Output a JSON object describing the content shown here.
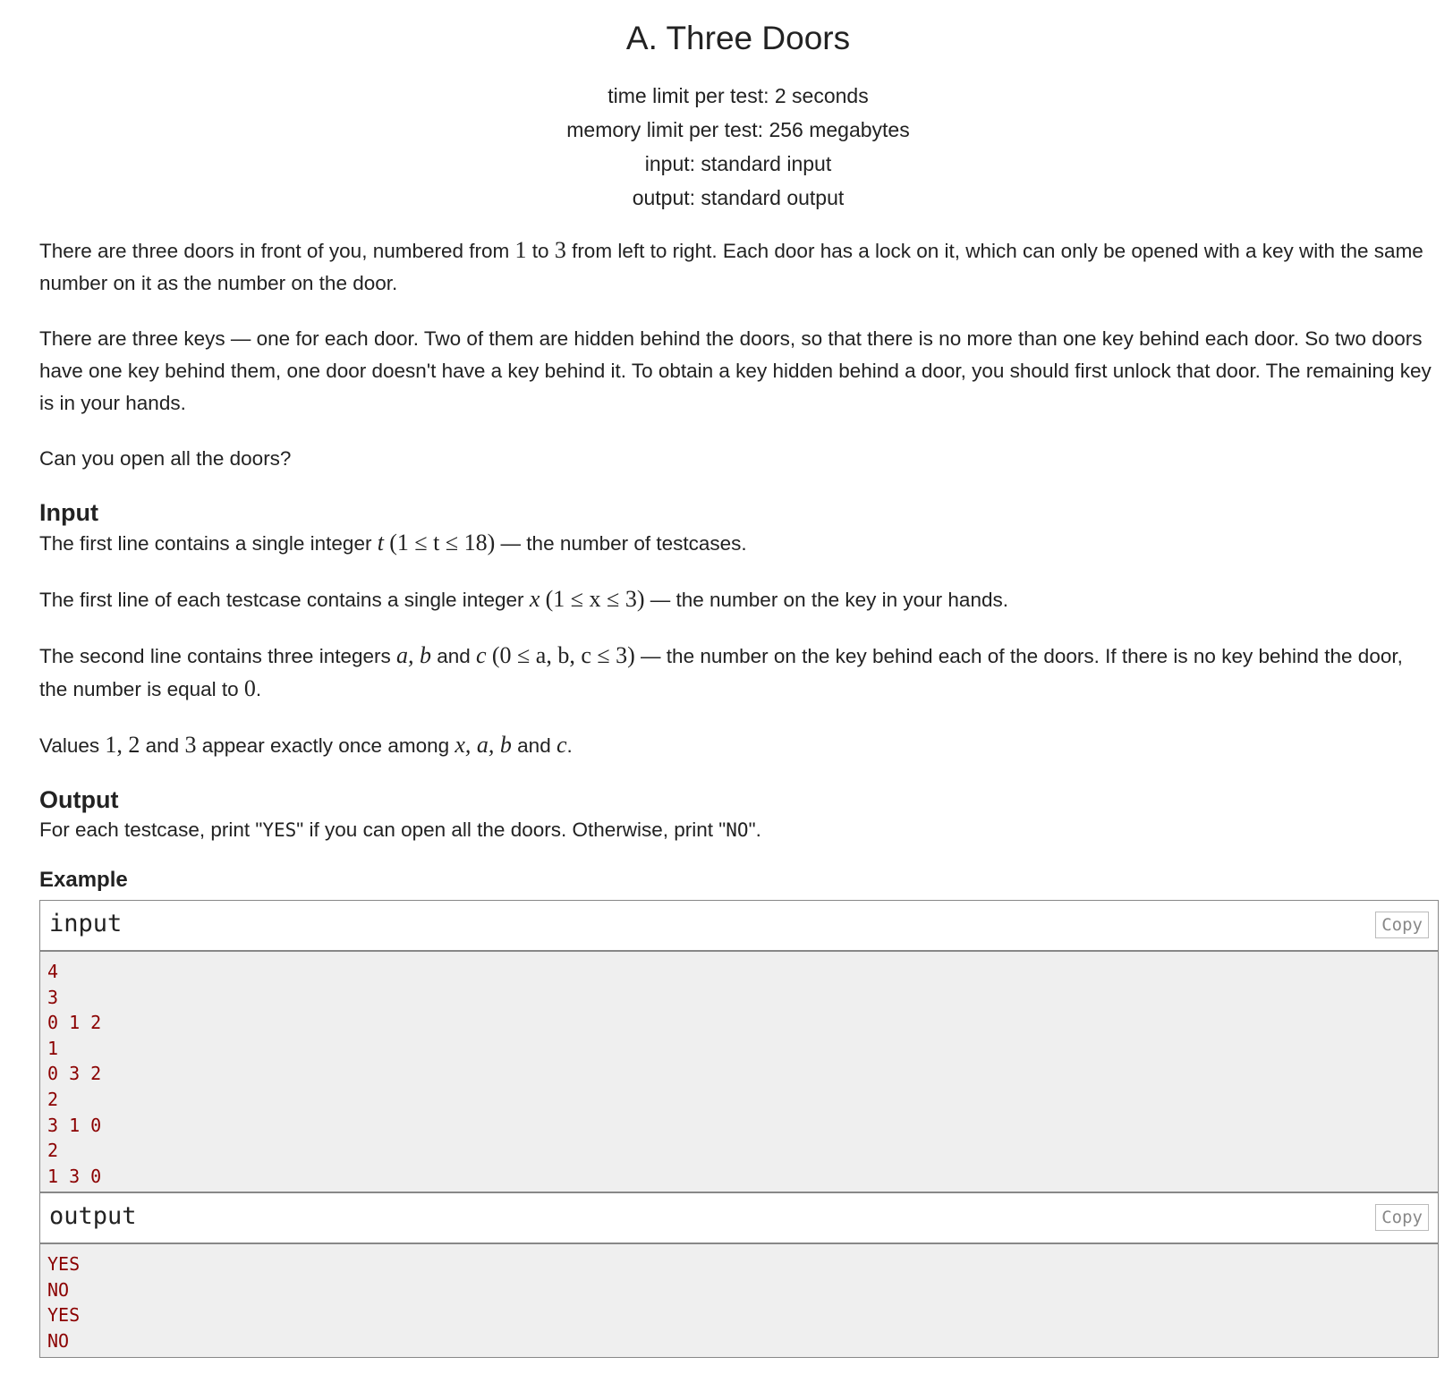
{
  "title": "A. Three Doors",
  "meta": [
    "time limit per test: 2 seconds",
    "memory limit per test: 256 megabytes",
    "input: standard input",
    "output: standard output"
  ],
  "legend": {
    "p1a": "There are three doors in front of you, numbered from ",
    "p1n1": "1",
    "p1b": " to ",
    "p1n2": "3",
    "p1c": " from left to right. Each door has a lock on it, which can only be opened with a key with the same number on it as the number on the door.",
    "p2": "There are three keys — one for each door. Two of them are hidden behind the doors, so that there is no more than one key behind each door. So two doors have one key behind them, one door doesn't have a key behind it. To obtain a key hidden behind a door, you should first unlock that door. The remaining key is in your hands.",
    "p3": "Can you open all the doors?"
  },
  "input_spec": {
    "heading": "Input",
    "l1a": "The first line contains a single integer ",
    "l1t": "t",
    "l1m": "(1 ≤ t ≤ 18)",
    "l1b": " — the number of testcases.",
    "l2a": "The first line of each testcase contains a single integer ",
    "l2x": "x",
    "l2m": "(1 ≤ x ≤ 3)",
    "l2b": " — the number on the key in your hands.",
    "l3a": "The second line contains three integers ",
    "l3abc": "a, b",
    "l3and": " and ",
    "l3c": "c",
    "l3m": "(0 ≤ a, b, c ≤ 3)",
    "l3b": " — the number on the key behind each of the doors. If there is no key behind the door, the number is equal to ",
    "l3z": "0",
    "l3end": ".",
    "l4a": "Values ",
    "l4n": "1, 2",
    "l4and": " and ",
    "l4n3": "3",
    "l4b": " appear exactly once among ",
    "l4v": "x, a, b",
    "l4and2": " and ",
    "l4c": "c",
    "l4end": "."
  },
  "output_spec": {
    "heading": "Output",
    "a": "For each testcase, print \"",
    "yes": "YES",
    "b": "\" if you can open all the doors. Otherwise, print \"",
    "no": "NO",
    "c": "\"."
  },
  "example": {
    "label": "Example",
    "input_label": "input",
    "output_label": "output",
    "copy": "Copy",
    "input_lines": [
      "4",
      "3",
      "0 1 2",
      "1",
      "0 3 2",
      "2",
      "3 1 0",
      "2",
      "1 3 0"
    ],
    "output_lines": [
      "YES",
      "NO",
      "YES",
      "NO"
    ]
  }
}
